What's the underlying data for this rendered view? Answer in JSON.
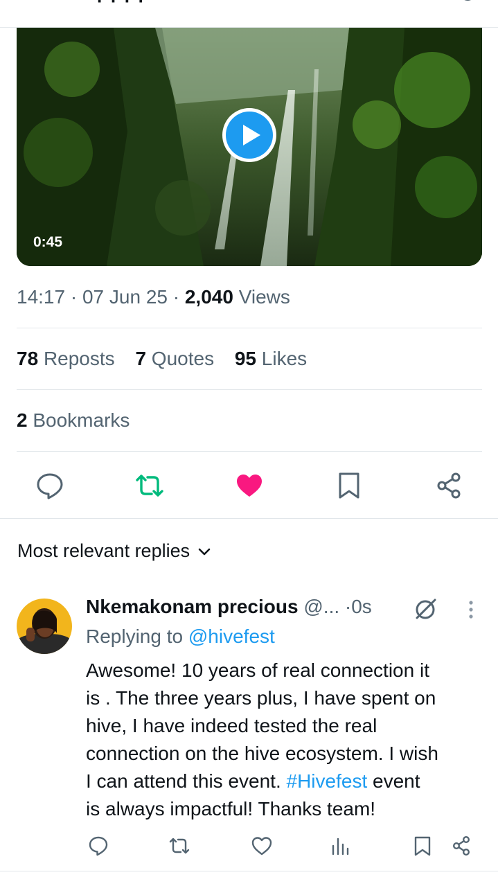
{
  "video": {
    "duration": "0:45"
  },
  "meta": {
    "time": "14:17",
    "date": "07 Jun 25",
    "views_count": "2,040",
    "views_label": "Views",
    "separator": " · "
  },
  "stats": {
    "reposts_count": "78",
    "reposts_label": "Reposts",
    "quotes_count": "7",
    "quotes_label": "Quotes",
    "likes_count": "95",
    "likes_label": "Likes",
    "bookmarks_count": "2",
    "bookmarks_label": "Bookmarks"
  },
  "actions": {
    "reply": "reply-icon",
    "repost": "repost-icon",
    "like": "heart-icon",
    "bookmark": "bookmark-icon",
    "share": "share-icon",
    "repost_color": "#00ba7c",
    "like_color": "#f91880"
  },
  "replies_sort": {
    "label": "Most relevant replies"
  },
  "reply": {
    "name": "Nkemakonam precious",
    "handle": "@...",
    "time": "0s",
    "time_sep": "·",
    "replying_prefix": "Replying to ",
    "replying_handle": "@hivefest",
    "body_lines": [
      "Awesome! 10 years of real connection it",
      "is .  The three years plus,  I have spent on",
      "hive, I have indeed tested the real",
      "connection on the hive ecosystem. I wish",
      "I can attend this event. ",
      "is always impactful!  Thanks team!"
    ],
    "hashtag": "#Hivefest",
    "after_hashtag": " event"
  },
  "colors": {
    "accent": "#1d9bf0",
    "muted": "#536471",
    "text": "#0f1419"
  }
}
